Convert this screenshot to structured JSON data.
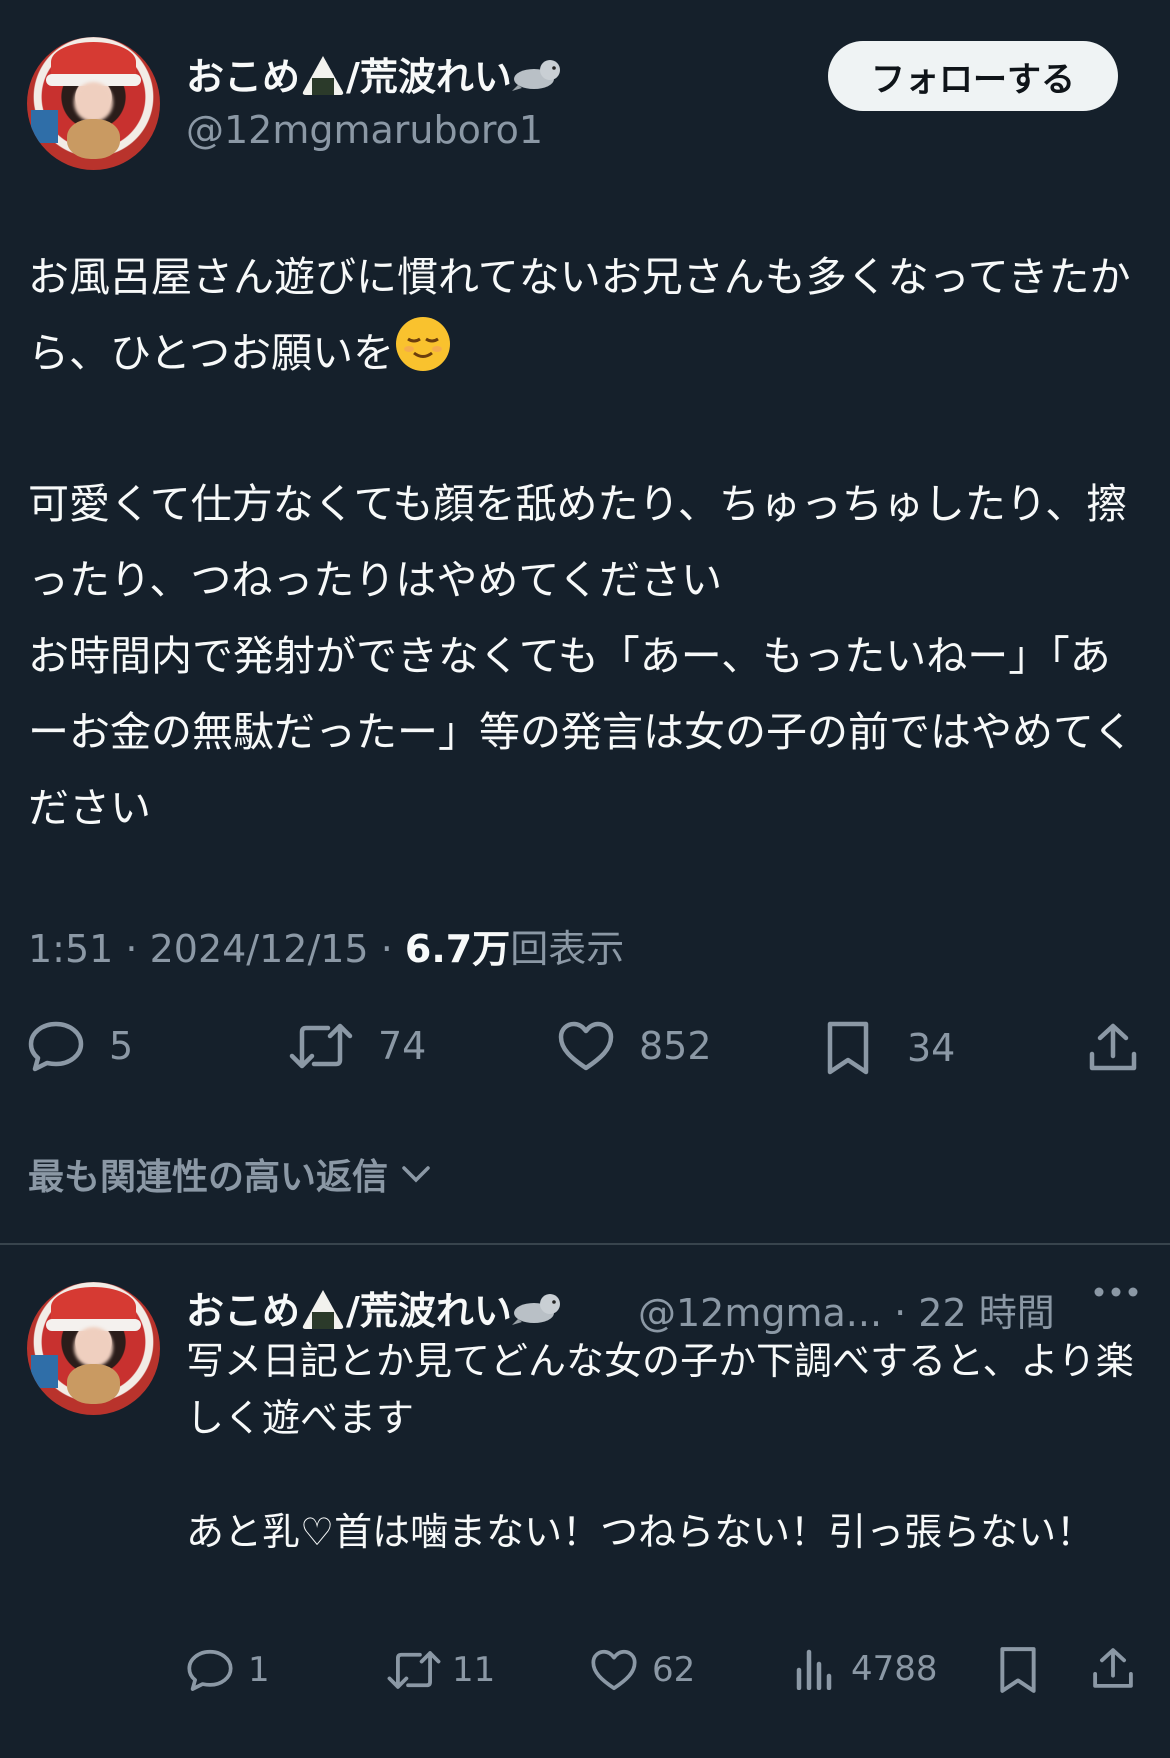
{
  "tweet": {
    "display_name": "おこめ",
    "display_name_suffix": "/荒波れい",
    "name_emojis": [
      "rice-ball",
      "seal"
    ],
    "handle": "@12mgmaruboro1",
    "follow_label": "フォローする",
    "paragraph1": "お風呂屋さん遊びに慣れてないお兄さんも多くなってきたから、ひとつお願いを",
    "paragraph2": "可愛くて仕方なくても顔を舐めたり、ちゅっちゅしたり、擦ったり、つねったりはやめてください\nお時間内で発射ができなくても「あー、もったいねー」「あーお金の無駄だったー」等の発言は女の子の前ではやめてください",
    "time": "1:51",
    "date": "2024/12/15",
    "views": "6.7万",
    "views_suffix": "回表示",
    "stats": {
      "replies": "5",
      "retweets": "74",
      "likes": "852",
      "bookmarks": "34"
    }
  },
  "relevant_label": "最も関連性の高い返信",
  "reply": {
    "display_name": "おこめ",
    "display_name_suffix": "/荒波れい",
    "handle": "@12mgma...",
    "time": "· 22 時間",
    "text": "写メ日記とか見てどんな女の子か下調べすると、より楽しく遊べます\n\nあと乳♡首は噛まない！つねらない！引っ張らない！",
    "stats": {
      "replies": "1",
      "retweets": "11",
      "likes": "62",
      "views": "4788"
    }
  },
  "colors": {
    "background": "#15202b",
    "text": "#f7f9f9",
    "secondary": "#8b98a5",
    "divider": "#38444d",
    "follow_bg": "#eff3f4"
  }
}
